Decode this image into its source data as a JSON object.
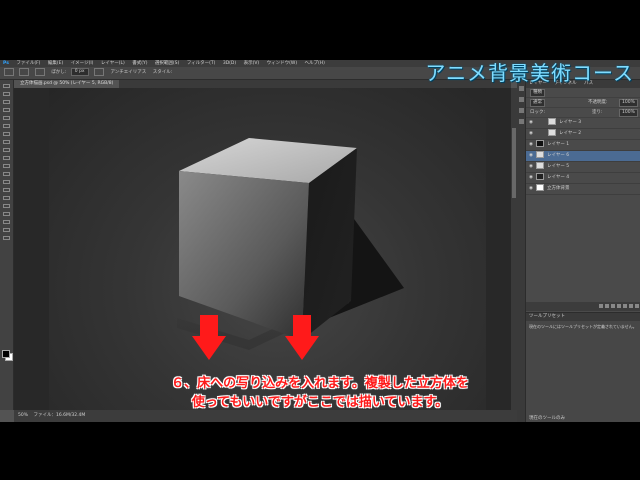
{
  "overlay_title": "アニメ背景美術コース",
  "caption_lines": [
    "６、床への写り込みを入れます。複製した立方体を",
    "使ってもいいですがここでは描いています。"
  ],
  "app_logo": "Ps",
  "menu": [
    "ファイル(F)",
    "編集(E)",
    "イメージ(I)",
    "レイヤー(L)",
    "書式(Y)",
    "選択範囲(S)",
    "フィルター(T)",
    "3D(D)",
    "表示(V)",
    "ウィンドウ(W)",
    "ヘルプ(H)"
  ],
  "options": {
    "feather_label": "ぼかし:",
    "feather_value": "0 px",
    "antialias_label": "アンチエイリアス",
    "style_label": "スタイル:"
  },
  "document_tab": "立方体描画.psd @ 50% (レイヤー 5, RGB/8)",
  "status": {
    "zoom": "50%",
    "doc_info": "ファイル：16.6M/32.4M"
  },
  "panel": {
    "tabs": [
      "レイヤー",
      "チャンネル",
      "パス"
    ],
    "kind_label": "種類",
    "blend_mode": "通常",
    "opacity_label": "不透明度:",
    "opacity_value": "100%",
    "lock_label": "ロック:",
    "fill_label": "塗り:",
    "fill_value": "100%",
    "layers": [
      {
        "name": "レイヤー 3",
        "selected": false
      },
      {
        "name": "レイヤー 2",
        "selected": false
      },
      {
        "name": "レイヤー 1",
        "selected": false
      },
      {
        "name": "レイヤー 6",
        "selected": true
      },
      {
        "name": "レイヤー 5",
        "selected": false
      },
      {
        "name": "レイヤー 4",
        "selected": false
      },
      {
        "name": "立方体背景",
        "selected": false
      }
    ],
    "tool_presets_title": "ツールプリセット",
    "tool_presets_text": "現在のツールにはツールプリセットが定義されていません。",
    "current_tool_only": "現在のツールのみ"
  },
  "colors": {
    "arrow": "#ff1a1a",
    "caption": "#ff1a1a",
    "title": "#7fdcff"
  }
}
